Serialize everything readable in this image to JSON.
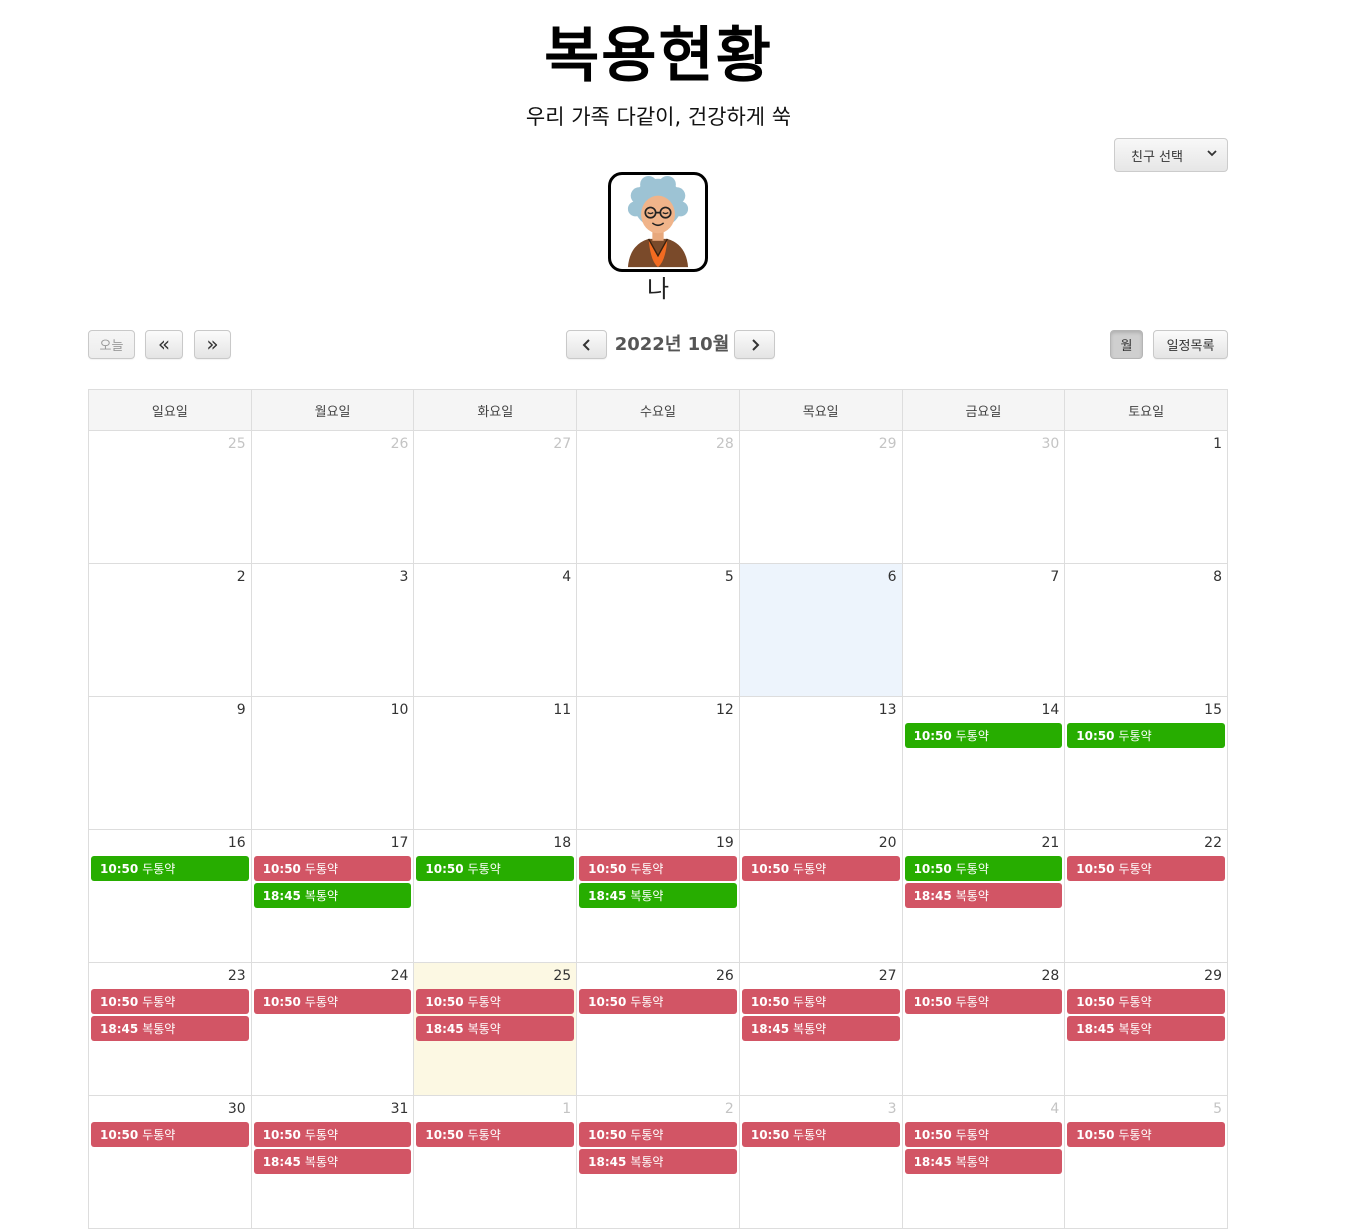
{
  "header": {
    "title": "복용현황",
    "subtitle": "우리 가족 다같이, 건강하게 쑥"
  },
  "friend_select": {
    "value": "친구 선택"
  },
  "profile": {
    "name": "나",
    "avatar_icon": "grandmother-avatar-icon"
  },
  "toolbar": {
    "today_label": "오늘",
    "prev_year_label": "«",
    "next_year_label": "»",
    "month_title": "2022년 10월",
    "month_view_label": "월",
    "list_view_label": "일정목록"
  },
  "colors": {
    "taken": "#27ad00",
    "missed": "#d25565",
    "today_highlight": "#fcf8e3",
    "selected_day": "#edf4fc"
  },
  "calendar": {
    "weekdays": [
      "일요일",
      "월요일",
      "화요일",
      "수요일",
      "목요일",
      "금요일",
      "토요일"
    ],
    "days": [
      {
        "num": "25",
        "other": true,
        "events": []
      },
      {
        "num": "26",
        "other": true,
        "events": []
      },
      {
        "num": "27",
        "other": true,
        "events": []
      },
      {
        "num": "28",
        "other": true,
        "events": []
      },
      {
        "num": "29",
        "other": true,
        "events": []
      },
      {
        "num": "30",
        "other": true,
        "events": []
      },
      {
        "num": "1",
        "events": []
      },
      {
        "num": "2",
        "events": []
      },
      {
        "num": "3",
        "events": []
      },
      {
        "num": "4",
        "events": []
      },
      {
        "num": "5",
        "events": []
      },
      {
        "num": "6",
        "highlight": "a",
        "events": []
      },
      {
        "num": "7",
        "events": []
      },
      {
        "num": "8",
        "events": []
      },
      {
        "num": "9",
        "events": []
      },
      {
        "num": "10",
        "events": []
      },
      {
        "num": "11",
        "events": []
      },
      {
        "num": "12",
        "events": []
      },
      {
        "num": "13",
        "events": []
      },
      {
        "num": "14",
        "events": [
          {
            "time": "10:50",
            "name": "두통약",
            "status": "green"
          }
        ]
      },
      {
        "num": "15",
        "events": [
          {
            "time": "10:50",
            "name": "두통약",
            "status": "green"
          }
        ]
      },
      {
        "num": "16",
        "events": [
          {
            "time": "10:50",
            "name": "두통약",
            "status": "green"
          }
        ]
      },
      {
        "num": "17",
        "events": [
          {
            "time": "10:50",
            "name": "두통약",
            "status": "red"
          },
          {
            "time": "18:45",
            "name": "복통약",
            "status": "green"
          }
        ]
      },
      {
        "num": "18",
        "events": [
          {
            "time": "10:50",
            "name": "두통약",
            "status": "green"
          }
        ]
      },
      {
        "num": "19",
        "events": [
          {
            "time": "10:50",
            "name": "두통약",
            "status": "red"
          },
          {
            "time": "18:45",
            "name": "복통약",
            "status": "green"
          }
        ]
      },
      {
        "num": "20",
        "events": [
          {
            "time": "10:50",
            "name": "두통약",
            "status": "red"
          }
        ]
      },
      {
        "num": "21",
        "events": [
          {
            "time": "10:50",
            "name": "두통약",
            "status": "green"
          },
          {
            "time": "18:45",
            "name": "복통약",
            "status": "red"
          }
        ]
      },
      {
        "num": "22",
        "events": [
          {
            "time": "10:50",
            "name": "두통약",
            "status": "red"
          }
        ]
      },
      {
        "num": "23",
        "events": [
          {
            "time": "10:50",
            "name": "두통약",
            "status": "red"
          },
          {
            "time": "18:45",
            "name": "복통약",
            "status": "red"
          }
        ]
      },
      {
        "num": "24",
        "events": [
          {
            "time": "10:50",
            "name": "두통약",
            "status": "red"
          }
        ]
      },
      {
        "num": "25",
        "highlight": "b",
        "events": [
          {
            "time": "10:50",
            "name": "두통약",
            "status": "red"
          },
          {
            "time": "18:45",
            "name": "복통약",
            "status": "red"
          }
        ]
      },
      {
        "num": "26",
        "events": [
          {
            "time": "10:50",
            "name": "두통약",
            "status": "red"
          }
        ]
      },
      {
        "num": "27",
        "events": [
          {
            "time": "10:50",
            "name": "두통약",
            "status": "red"
          },
          {
            "time": "18:45",
            "name": "복통약",
            "status": "red"
          }
        ]
      },
      {
        "num": "28",
        "events": [
          {
            "time": "10:50",
            "name": "두통약",
            "status": "red"
          }
        ]
      },
      {
        "num": "29",
        "events": [
          {
            "time": "10:50",
            "name": "두통약",
            "status": "red"
          },
          {
            "time": "18:45",
            "name": "복통약",
            "status": "red"
          }
        ]
      },
      {
        "num": "30",
        "events": [
          {
            "time": "10:50",
            "name": "두통약",
            "status": "red"
          }
        ]
      },
      {
        "num": "31",
        "events": [
          {
            "time": "10:50",
            "name": "두통약",
            "status": "red"
          },
          {
            "time": "18:45",
            "name": "복통약",
            "status": "red"
          }
        ]
      },
      {
        "num": "1",
        "other": true,
        "events": [
          {
            "time": "10:50",
            "name": "두통약",
            "status": "red"
          }
        ]
      },
      {
        "num": "2",
        "other": true,
        "events": [
          {
            "time": "10:50",
            "name": "두통약",
            "status": "red"
          },
          {
            "time": "18:45",
            "name": "복통약",
            "status": "red"
          }
        ]
      },
      {
        "num": "3",
        "other": true,
        "events": [
          {
            "time": "10:50",
            "name": "두통약",
            "status": "red"
          }
        ]
      },
      {
        "num": "4",
        "other": true,
        "events": [
          {
            "time": "10:50",
            "name": "두통약",
            "status": "red"
          },
          {
            "time": "18:45",
            "name": "복통약",
            "status": "red"
          }
        ]
      },
      {
        "num": "5",
        "other": true,
        "events": [
          {
            "time": "10:50",
            "name": "두통약",
            "status": "red"
          }
        ]
      }
    ]
  }
}
